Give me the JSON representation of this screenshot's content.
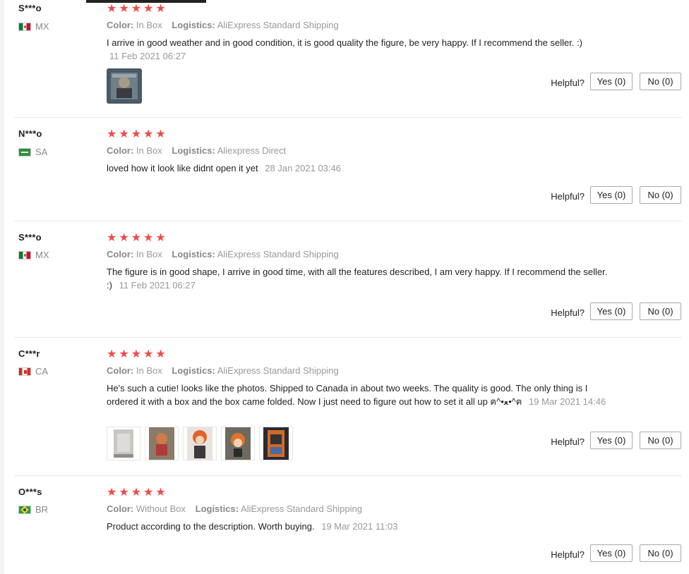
{
  "labels": {
    "color": "Color:",
    "logistics": "Logistics:",
    "helpful": "Helpful?",
    "yes": "Yes (0)",
    "no": "No (0)"
  },
  "star_icon": "star-icon",
  "star_color": "#f04a4a",
  "reviews": [
    {
      "user": "S***o",
      "country": "MX",
      "rating": 5,
      "color": "In Box",
      "logistics": "AliExpress Standard Shipping",
      "text": "I arrive in good weather and in good condition, it is good quality the figure, be very happy. If I recommend the seller. :)",
      "date": "11 Feb 2021 06:27",
      "photo_count": 1
    },
    {
      "user": "N***o",
      "country": "SA",
      "rating": 5,
      "color": "In Box",
      "logistics": "Aliexpress Direct",
      "text": "loved how it look like didnt open it yet",
      "date": "28 Jan 2021 03:46",
      "photo_count": 0
    },
    {
      "user": "S***o",
      "country": "MX",
      "rating": 5,
      "color": "In Box",
      "logistics": "AliExpress Standard Shipping",
      "text": "The figure is in good shape, I arrive in good time, with all the features described, I am very happy. If I recommend the seller. :)",
      "date": "11 Feb 2021 06:27",
      "photo_count": 0
    },
    {
      "user": "C***r",
      "country": "CA",
      "rating": 5,
      "color": "In Box",
      "logistics": "AliExpress Standard Shipping",
      "text": "He's such a cutie! looks like the photos. Shipped to Canada in about two weeks. The quality is good. The only thing is I ordered it with a box and the box came folded. Now I just need to figure out how to set it all up ฅ^•ﻌ•^ฅ",
      "date": "19 Mar 2021 14:46",
      "photo_count": 5
    },
    {
      "user": "O***s",
      "country": "BR",
      "rating": 5,
      "color": "Without Box",
      "logistics": "AliExpress Standard Shipping",
      "text": "Product according to the description. Worth buying.",
      "date": "19 Mar 2021 11:03",
      "photo_count": 0
    }
  ]
}
